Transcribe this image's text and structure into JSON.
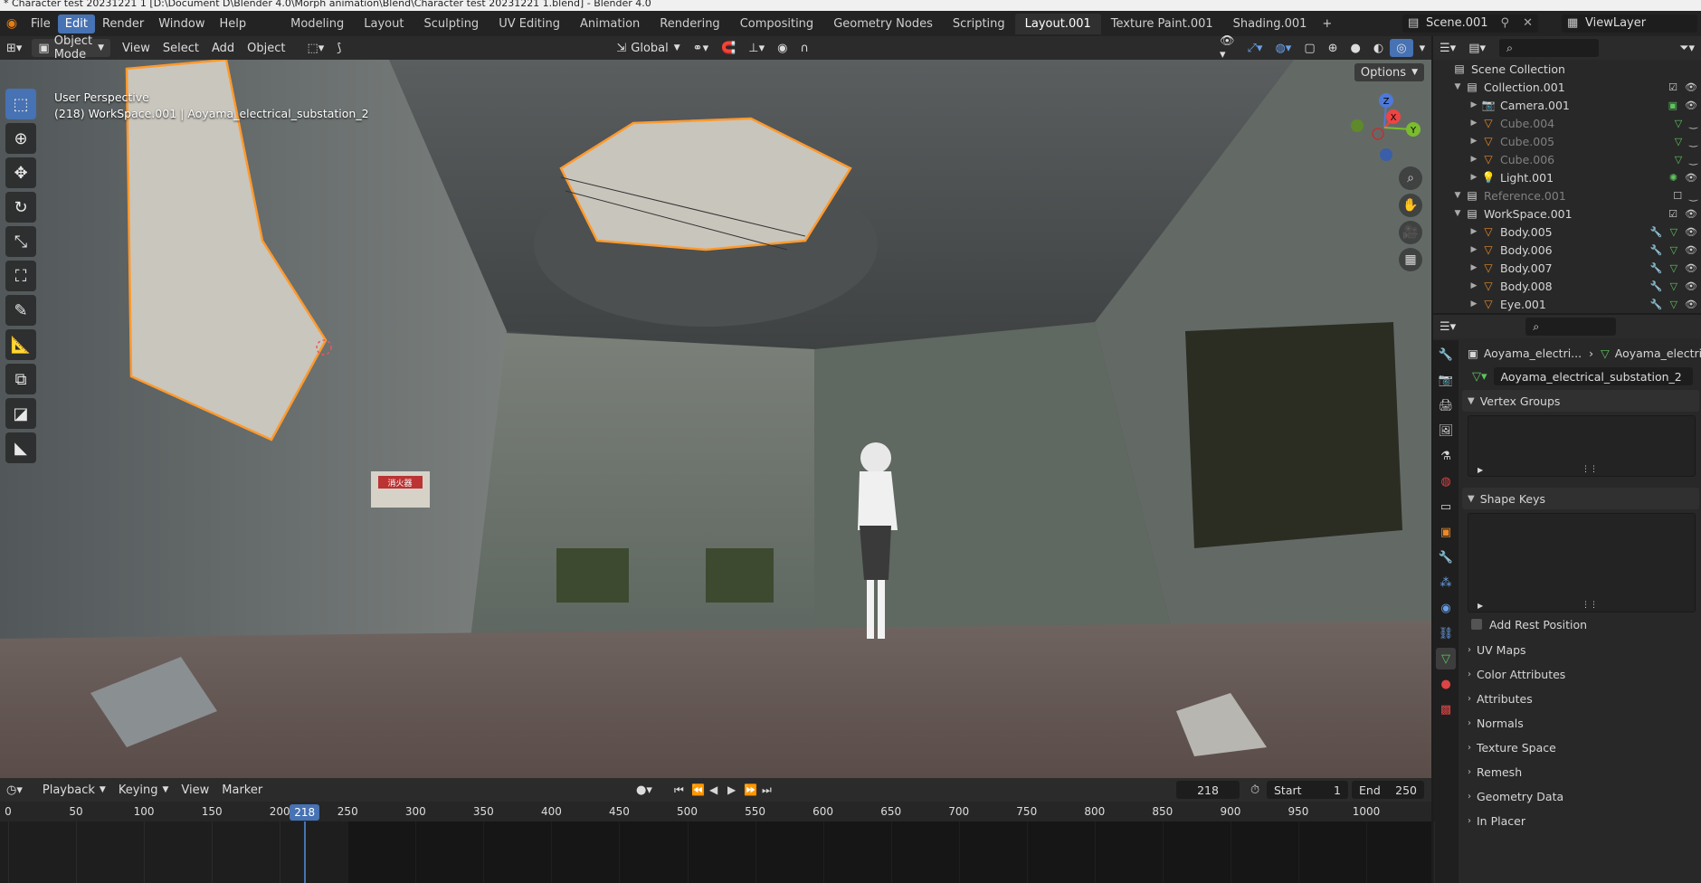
{
  "window_title": "* Character test 20231221 1 [D:\\Document D\\Blender 4.0\\Morph animation\\Blend\\Character test 20231221 1.blend] - Blender 4.0",
  "menu": [
    "File",
    "Edit",
    "Render",
    "Window",
    "Help"
  ],
  "active_menu": "Edit",
  "workspaces": [
    "Modeling",
    "Layout",
    "Sculpting",
    "UV Editing",
    "Animation",
    "Rendering",
    "Compositing",
    "Geometry Nodes",
    "Scripting",
    "Layout.001",
    "Texture Paint.001",
    "Shading.001"
  ],
  "active_workspace": "Layout.001",
  "scene_name": "Scene.001",
  "view_layer": "ViewLayer",
  "viewport_header": {
    "mode": "Object Mode",
    "menus": [
      "View",
      "Select",
      "Add",
      "Object"
    ],
    "transform_orientation": "Global",
    "options_label": "Options"
  },
  "viewport_overlay": {
    "perspective": "User Perspective",
    "object_info": "(218) WorkSpace.001 | Aoyama_electrical_substation_2"
  },
  "tools": [
    "select-box",
    "cursor",
    "move",
    "rotate",
    "scale",
    "transform",
    "annotate",
    "measure",
    "add-cube",
    "shrink",
    "extrude"
  ],
  "sign_text": "消火器",
  "axis_labels": {
    "z": "Z",
    "x": "X",
    "y": "Y"
  },
  "outliner": {
    "root": "Scene Collection",
    "rows": [
      {
        "name": "Collection.001",
        "indent": 1,
        "type": "collection",
        "dim": false
      },
      {
        "name": "Camera.001",
        "indent": 2,
        "type": "camera",
        "dim": false
      },
      {
        "name": "Cube.004",
        "indent": 2,
        "type": "mesh",
        "dim": true
      },
      {
        "name": "Cube.005",
        "indent": 2,
        "type": "mesh",
        "dim": true
      },
      {
        "name": "Cube.006",
        "indent": 2,
        "type": "mesh",
        "dim": true
      },
      {
        "name": "Light.001",
        "indent": 2,
        "type": "light",
        "dim": false
      },
      {
        "name": "Reference.001",
        "indent": 1,
        "type": "collection",
        "dim": true
      },
      {
        "name": "WorkSpace.001",
        "indent": 1,
        "type": "collection",
        "dim": false
      },
      {
        "name": "Body.005",
        "indent": 2,
        "type": "mesh",
        "dim": false
      },
      {
        "name": "Body.006",
        "indent": 2,
        "type": "mesh",
        "dim": false
      },
      {
        "name": "Body.007",
        "indent": 2,
        "type": "mesh",
        "dim": false
      },
      {
        "name": "Body.008",
        "indent": 2,
        "type": "mesh",
        "dim": false
      },
      {
        "name": "Eye.001",
        "indent": 2,
        "type": "mesh",
        "dim": false
      }
    ]
  },
  "properties": {
    "breadcrumb_object": "Aoyama_electri...",
    "breadcrumb_data": "Aoyama_electri...",
    "mesh_name": "Aoyama_electrical_substation_2",
    "sections_open": [
      "Vertex Groups",
      "Shape Keys"
    ],
    "add_rest_position": "Add Rest Position",
    "sections_closed": [
      "UV Maps",
      "Color Attributes",
      "Attributes",
      "Normals",
      "Texture Space",
      "Remesh",
      "Geometry Data",
      "In Placer"
    ]
  },
  "timeline": {
    "menus": [
      "Playback",
      "Keying",
      "View",
      "Marker"
    ],
    "current_frame": 218,
    "current_frame_label": "218",
    "start_label": "Start",
    "start": "1",
    "end_label": "End",
    "end": "250",
    "ticks": [
      0,
      50,
      100,
      150,
      200,
      250,
      300,
      350,
      400,
      450,
      500,
      550,
      600,
      650,
      700,
      750,
      800,
      850,
      900,
      950,
      1000
    ],
    "tick_labels": [
      "0",
      "50",
      "100",
      "150",
      "200",
      "250",
      "300",
      "350",
      "400",
      "450",
      "500",
      "550",
      "600",
      "650",
      "700",
      "750",
      "800",
      "850",
      "900",
      "950",
      "1000"
    ],
    "frame_end_ruler": 250
  }
}
